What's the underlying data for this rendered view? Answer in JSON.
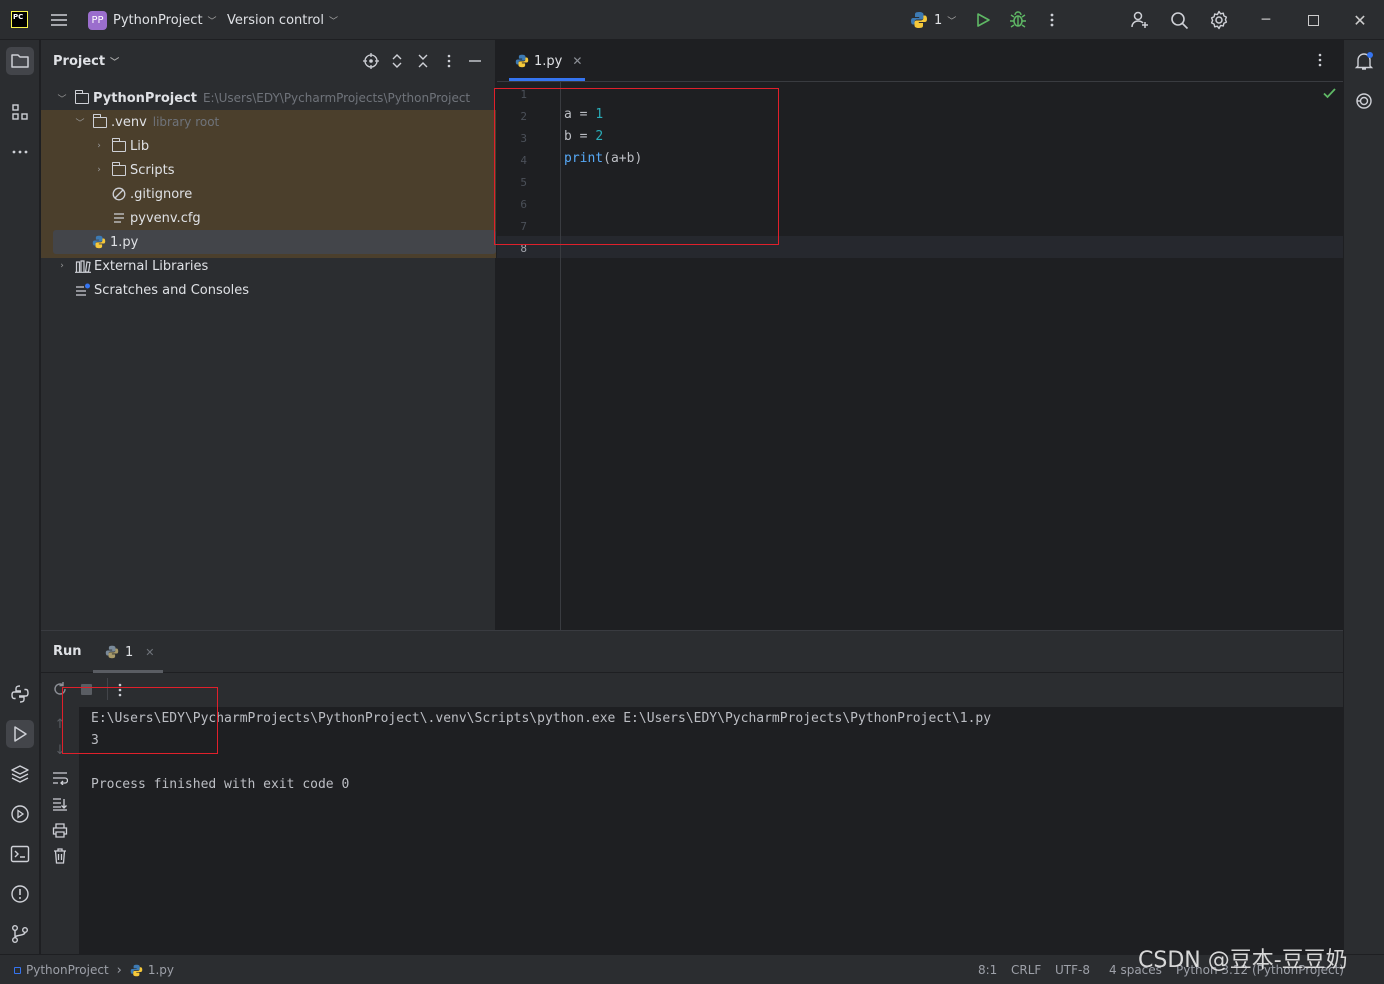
{
  "titlebar": {
    "app_logo": "PC",
    "project_badge": "PP",
    "project_name": "PythonProject",
    "version_control": "Version control",
    "run_config": "1"
  },
  "project_panel": {
    "title": "Project",
    "tree": [
      {
        "label": "PythonProject",
        "hint": "E:\\Users\\EDY\\PycharmProjects\\PythonProject"
      },
      {
        "label": ".venv",
        "hint": "library root"
      },
      {
        "label": "Lib"
      },
      {
        "label": "Scripts"
      },
      {
        "label": ".gitignore"
      },
      {
        "label": "pyvenv.cfg"
      },
      {
        "label": "1.py"
      },
      {
        "label": "External Libraries"
      },
      {
        "label": "Scratches and Consoles"
      }
    ]
  },
  "editor": {
    "tab_label": "1.py",
    "line_numbers": [
      "1",
      "2",
      "3",
      "4",
      "5",
      "6",
      "7",
      "8"
    ],
    "code": [
      {
        "var": "a",
        "op": " = ",
        "val": "1"
      },
      {
        "var": "b",
        "op": " = ",
        "val": "2"
      },
      {
        "fn": "print",
        "args": "(a+b)"
      }
    ]
  },
  "run_panel": {
    "title": "Run",
    "tab_label": "1",
    "output": [
      "E:\\Users\\EDY\\PycharmProjects\\PythonProject\\.venv\\Scripts\\python.exe E:\\Users\\EDY\\PycharmProjects\\PythonProject\\1.py",
      "3",
      "",
      "Process finished with exit code 0"
    ]
  },
  "statusbar": {
    "breadcrumb_project": "PythonProject",
    "breadcrumb_file": "1.py",
    "position": "8:1",
    "line_sep": "CRLF",
    "encoding": "UTF-8",
    "indent": "4 spaces",
    "interpreter": "Python 3.12 (PythonProject)"
  },
  "watermark": "CSDN @豆本-豆豆奶",
  "colors": {
    "accent": "#3574f0",
    "highlight_box": "#e0202b",
    "venv_bg": "#4b3f2c",
    "run_green": "#5fb865"
  }
}
